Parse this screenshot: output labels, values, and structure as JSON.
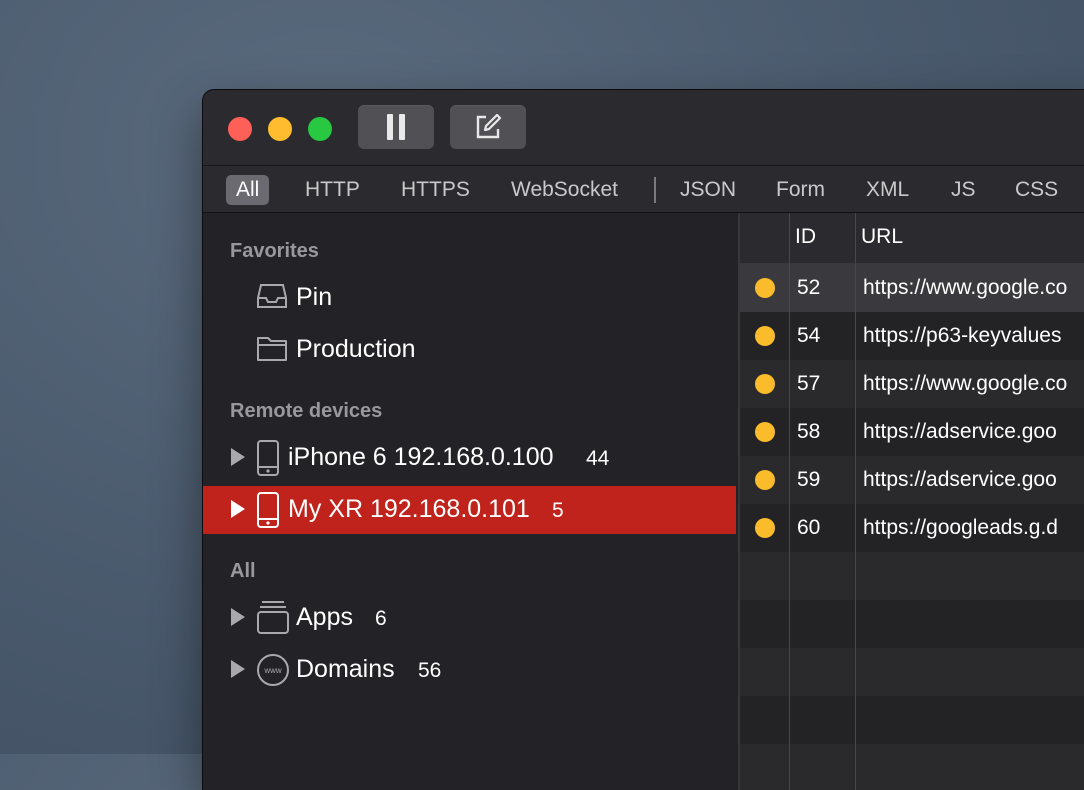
{
  "toolbar": {
    "pause_icon": "pause-icon",
    "compose_icon": "compose-icon"
  },
  "filters": [
    "All",
    "HTTP",
    "HTTPS",
    "WebSocket",
    "JSON",
    "Form",
    "XML",
    "JS",
    "CSS"
  ],
  "sidebar": {
    "favorites_title": "Favorites",
    "favorites": [
      {
        "label": "Pin",
        "icon": "tray-icon"
      },
      {
        "label": "Production",
        "icon": "folder-icon"
      }
    ],
    "remote_title": "Remote devices",
    "devices": [
      {
        "label": "iPhone 6 192.168.0.100",
        "count": "44",
        "icon": "phone-icon"
      },
      {
        "label": "My XR 192.168.0.101",
        "count": "5",
        "icon": "phone-icon",
        "selected": true
      }
    ],
    "all_title": "All",
    "all_items": [
      {
        "label": "Apps",
        "count": "6",
        "icon": "apps-stack-icon"
      },
      {
        "label": "Domains",
        "count": "56",
        "icon": "www-globe-icon"
      }
    ]
  },
  "table": {
    "columns": [
      "ID",
      "URL"
    ],
    "rows": [
      {
        "id": "52",
        "url": "https://www.google.co"
      },
      {
        "id": "54",
        "url": "https://p63-keyvalues"
      },
      {
        "id": "57",
        "url": "https://www.google.co"
      },
      {
        "id": "58",
        "url": "https://adservice.goo"
      },
      {
        "id": "59",
        "url": "https://adservice.goo"
      },
      {
        "id": "60",
        "url": "https://googleads.g.d"
      }
    ],
    "status_color": "#fcbb2b"
  },
  "colors": {
    "selection": "#c0231c",
    "window_bg": "#232327"
  }
}
